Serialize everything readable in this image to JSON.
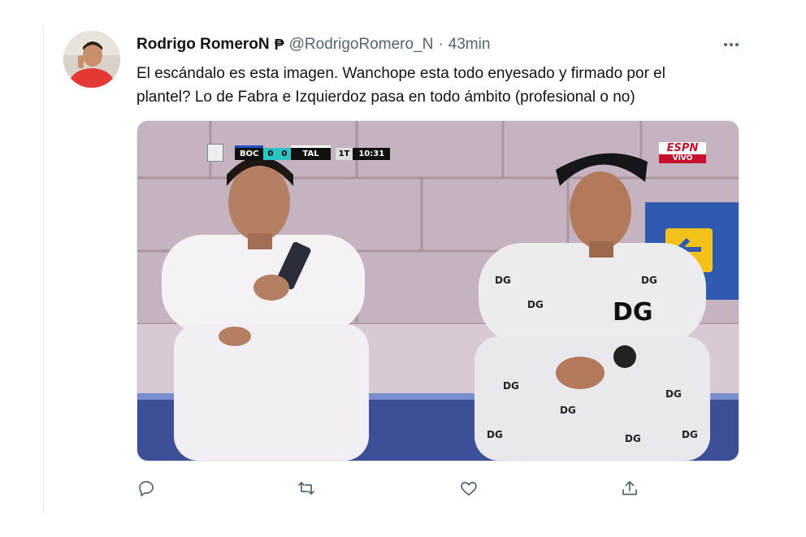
{
  "tweet": {
    "display_name": "Rodrigo RomeroN",
    "badge": "₱",
    "handle": "@RodrigoRomero_N",
    "separator": "·",
    "time": "43min",
    "text": "El escándalo es esta imagen. Wanchope esta todo enyesado y firmado por el\nplantel? Lo de Fabra e Izquierdoz  pasa en todo ámbito (profesional o no)"
  },
  "media": {
    "scorebug": {
      "home": "BOC",
      "home_score": "0",
      "away_score": "0",
      "away": "TAL",
      "period": "1T",
      "clock": "10:31"
    },
    "network": {
      "name": "ESPN",
      "live": "VIVO"
    },
    "shirt_text": "DG"
  },
  "actions": {
    "reply_icon": "reply-icon",
    "retweet_icon": "retweet-icon",
    "like_icon": "heart-icon",
    "share_icon": "share-icon"
  },
  "colors": {
    "text": "#0f1419",
    "secondary": "#536471",
    "divider": "#e6ecf0"
  }
}
